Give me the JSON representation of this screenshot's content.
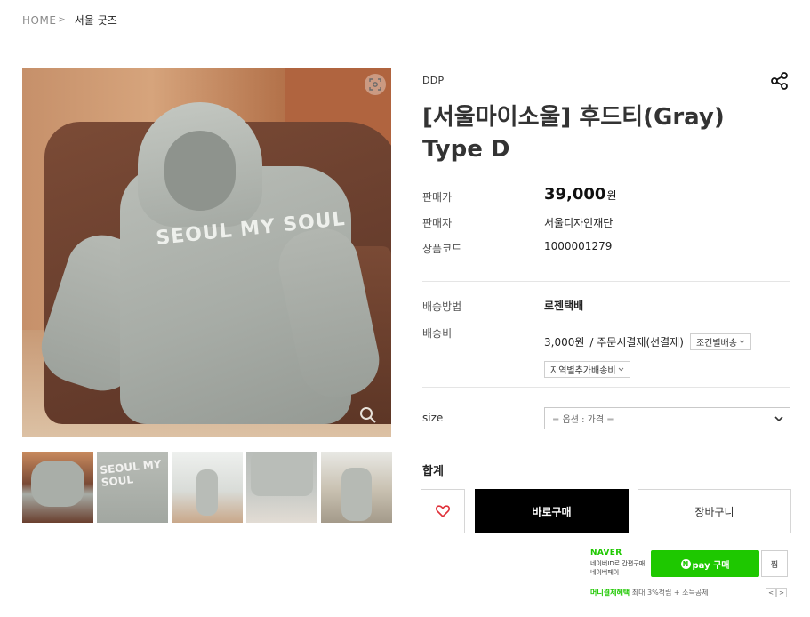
{
  "breadcrumb": {
    "home": "HOME",
    "separator": ">",
    "current": "서울 굿즈"
  },
  "gallery": {
    "main_print_text": "SEOUL MY SOUL",
    "zoom_icon": "expand-icon",
    "magnify_icon": "magnify-icon",
    "thumbs": [
      {
        "print": ""
      },
      {
        "print": "SEOUL MY SOUL"
      },
      {
        "print": ""
      },
      {
        "print": ""
      },
      {
        "print": ""
      }
    ]
  },
  "product": {
    "brand": "DDP",
    "title": "[서울마이소울] 후드티(Gray) Type D",
    "share_icon": "share-icon",
    "price_label": "판매가",
    "price": "39,000",
    "price_unit": "원",
    "seller_label": "판매자",
    "seller": "서울디자인재단",
    "code_label": "상품코드",
    "code": "1000001279"
  },
  "shipping": {
    "method_label": "배송방법",
    "method": "로젠택배",
    "fee_label": "배송비",
    "fee": "3,000원",
    "fee_method": "/ 주문시결제(선결제)",
    "condition_select": "조건별배송",
    "region_select": "지역별추가배송비"
  },
  "option": {
    "label": "size",
    "placeholder": "= 옵션 : 가격 ="
  },
  "total_label": "합계",
  "actions": {
    "wish_icon": "heart-icon",
    "buy_now": "바로구매",
    "cart": "장바구니"
  },
  "npay": {
    "logo": "NAVER",
    "desc_line1": "네이버ID로 간편구매",
    "desc_line2": "네이버페이",
    "button": "pay 구매",
    "button_badge": "N",
    "zzim": "찜",
    "benefit_highlight": "머니결제혜택",
    "benefit_text": "최대 3%적립 + 소득공제",
    "prev": "<",
    "next": ">"
  },
  "colors": {
    "npay_green": "#1ec800",
    "buy_button": "#000000"
  }
}
